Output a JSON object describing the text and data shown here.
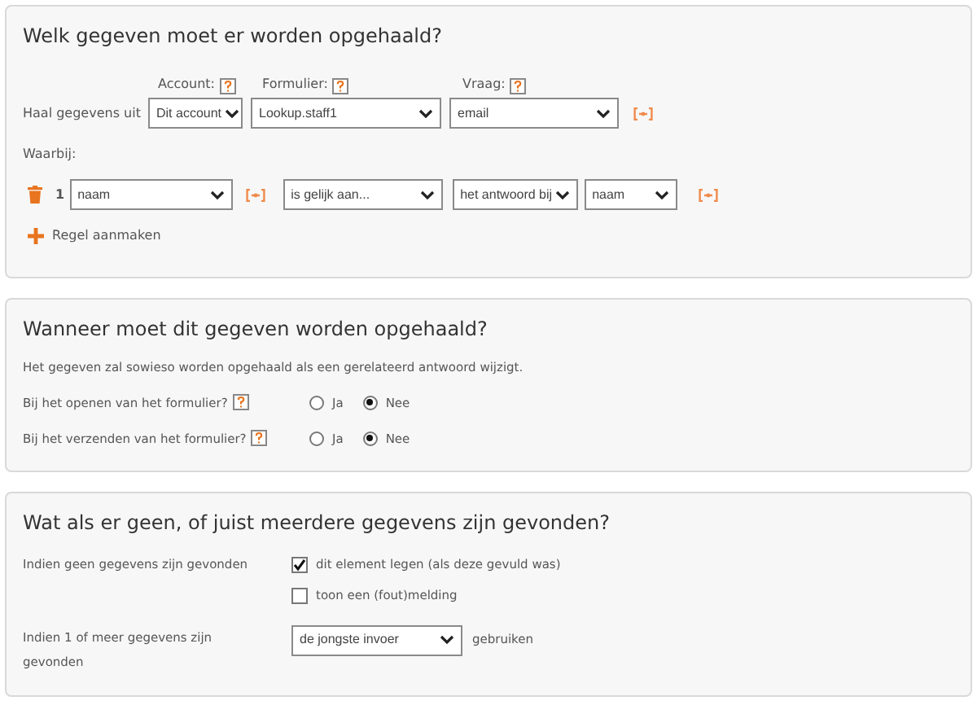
{
  "sections": [
    {
      "kind": "lookup",
      "title": "Welk gegeven moet er worden opgehaald?",
      "source_headers": [
        {
          "label": "Account:"
        },
        {
          "label": "Formulier:"
        },
        {
          "label": "Vraag:"
        }
      ],
      "source_label": "Haal gegevens uit",
      "source_selects": [
        "Dit account",
        "Lookup.staff1",
        "email"
      ],
      "condition_label": "Waarbij:",
      "conditions": [
        {
          "number": "1",
          "field": "naam",
          "operator": "is gelijk aan...",
          "value_type": "het antwoord bij",
          "value": "naam"
        }
      ],
      "add_button": "Regel aanmaken"
    },
    {
      "kind": "when",
      "title": "Wanneer moet dit gegeven worden opgehaald?",
      "note": "Het gegeven zal sowieso worden opgehaald als een gerelateerd antwoord wijzigt.",
      "questions": [
        {
          "label": "Bij het openen van het formulier?",
          "options": [
            {
              "label": "Ja",
              "selected": false
            },
            {
              "label": "Nee",
              "selected": true
            }
          ]
        },
        {
          "label": "Bij het verzenden van het formulier?",
          "options": [
            {
              "label": "Ja",
              "selected": false
            },
            {
              "label": "Nee",
              "selected": true
            }
          ]
        }
      ]
    },
    {
      "kind": "results",
      "title": "Wat als er geen, of juist meerdere gegevens zijn gevonden?",
      "none_label": "Indien geen gegevens zijn gevonden",
      "none_options": [
        {
          "label": "dit element legen (als deze gevuld was)",
          "checked": true
        },
        {
          "label": "toon een (fout)melding",
          "checked": false
        }
      ],
      "found_label": "Indien 1 of meer gegevens zijn gevonden",
      "found_select": "de jongste invoer",
      "found_suffix": "gebruiken"
    }
  ]
}
